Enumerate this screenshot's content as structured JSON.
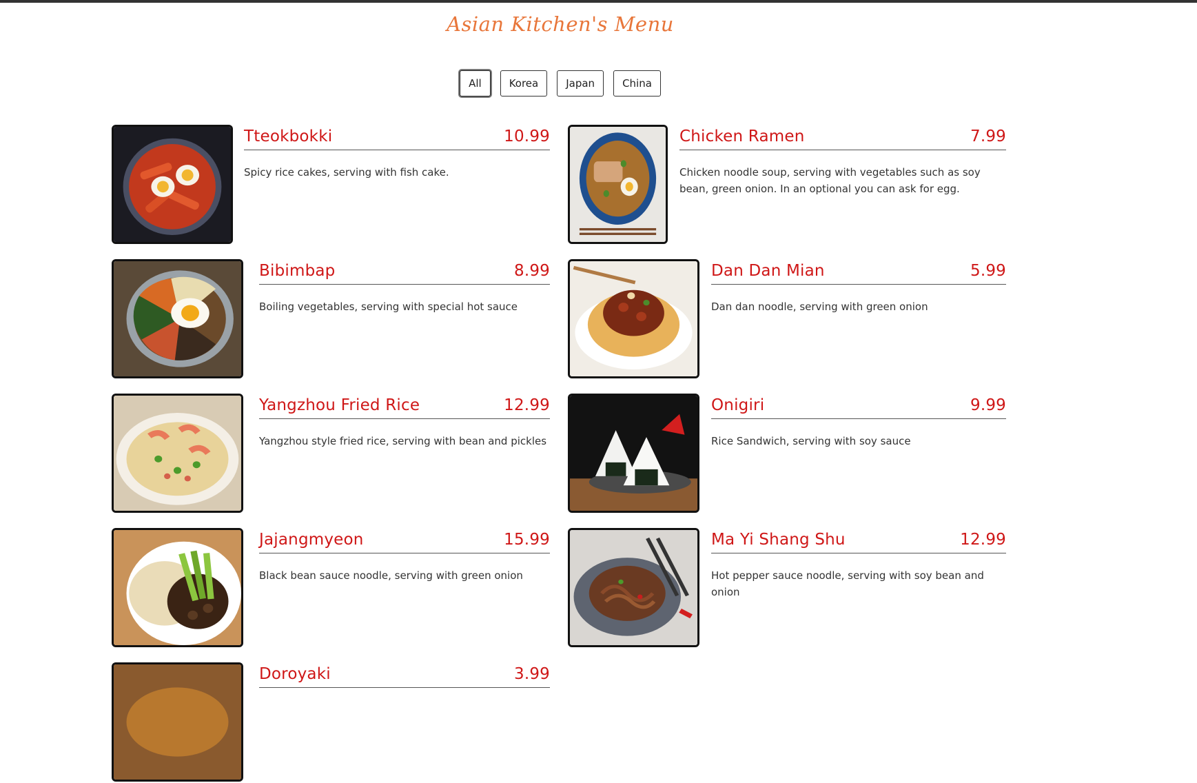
{
  "page": {
    "title": "Asian Kitchen's Menu"
  },
  "filters": [
    {
      "label": "All",
      "active": true
    },
    {
      "label": "Korea",
      "active": false
    },
    {
      "label": "Japan",
      "active": false
    },
    {
      "label": "China",
      "active": false
    }
  ],
  "menu": [
    {
      "name": "Tteokbokki",
      "price": "10.99",
      "desc": "Spicy rice cakes, serving with fish cake."
    },
    {
      "name": "Chicken Ramen",
      "price": "7.99",
      "desc": "Chicken noodle soup, serving with vegetables such as soy bean, green onion. In an optional you can ask for egg."
    },
    {
      "name": "Bibimbap",
      "price": "8.99",
      "desc": "Boiling vegetables, serving with special hot sauce"
    },
    {
      "name": "Dan Dan Mian",
      "price": "5.99",
      "desc": "Dan dan noodle, serving with green onion"
    },
    {
      "name": "Yangzhou Fried Rice",
      "price": "12.99",
      "desc": "Yangzhou style fried rice, serving with bean and pickles"
    },
    {
      "name": "Onigiri",
      "price": "9.99",
      "desc": "Rice Sandwich, serving with soy sauce"
    },
    {
      "name": "Jajangmyeon",
      "price": "15.99",
      "desc": "Black bean sauce noodle, serving with green onion"
    },
    {
      "name": "Ma Yi Shang Shu",
      "price": "12.99",
      "desc": "Hot pepper sauce noodle, serving with soy bean and onion"
    },
    {
      "name": "Doroyaki",
      "price": "3.99",
      "desc": ""
    }
  ],
  "colors": {
    "title": "#e8763a",
    "item_text": "#cf1717",
    "border": "#111111"
  }
}
